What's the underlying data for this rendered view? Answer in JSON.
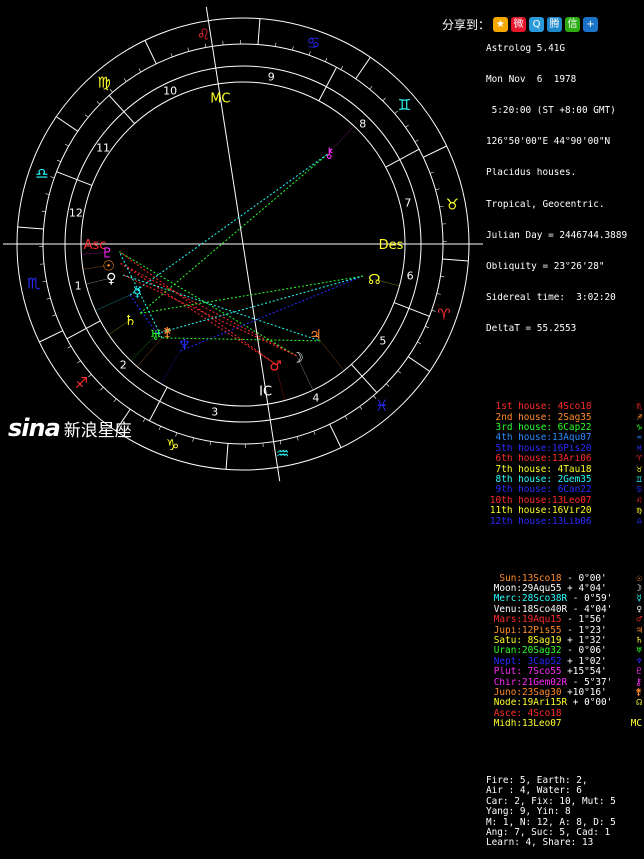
{
  "header": {
    "lines": [
      "Astrolog 5.41G",
      "Mon Nov  6  1978",
      " 5:20:00 (ST +8:00 GMT)",
      "126°50'00\"E 44°90'00\"N",
      "Placidus houses.",
      "Tropical, Geocentric.",
      "Julian Day = 2446744.3889",
      "Obliquity = 23°26'28\"",
      "Sidereal time:  3:02:20",
      "DeltaT = 55.2553"
    ]
  },
  "share": {
    "label": "分享到：",
    "icons": [
      {
        "name": "star-share-icon",
        "glyph": "★",
        "color": "#f7a800"
      },
      {
        "name": "weibo-share-icon",
        "glyph": "微",
        "color": "#e6162d"
      },
      {
        "name": "qzone-share-icon",
        "glyph": "Q",
        "color": "#2a9ad8"
      },
      {
        "name": "tencent-share-icon",
        "glyph": "腾",
        "color": "#1e88c8"
      },
      {
        "name": "wechat-share-icon",
        "glyph": "信",
        "color": "#2bad13"
      },
      {
        "name": "more-share-icon",
        "glyph": "+",
        "color": "#1a73c8"
      }
    ]
  },
  "houses": [
    {
      "label": "1st house:",
      "value": " 4Sco18",
      "color": "#ff2b2b",
      "sym": "♏"
    },
    {
      "label": "2nd house:",
      "value": " 2Sag35",
      "color": "#ff8c2b",
      "sym": "♐"
    },
    {
      "label": "3rd house:",
      "value": " 6Cap22",
      "color": "#2bff2b",
      "sym": "♑"
    },
    {
      "label": "4th house:",
      "value": "13Aqu07",
      "color": "#2b8cff",
      "sym": "♒"
    },
    {
      "label": "5th house:",
      "value": "16Pis20",
      "color": "#2b2bff",
      "sym": "♓"
    },
    {
      "label": "6th house:",
      "value": "13Ari06",
      "color": "#ff2b2b",
      "sym": "♈"
    },
    {
      "label": "7th house:",
      "value": " 4Tau18",
      "color": "#ffff2b",
      "sym": "♉"
    },
    {
      "label": "8th house:",
      "value": " 2Gem35",
      "color": "#2bffff",
      "sym": "♊"
    },
    {
      "label": "9th house:",
      "value": " 6Can22",
      "color": "#2b2bff",
      "sym": "♋"
    },
    {
      "label": "10th house:",
      "value": "13Leo07",
      "color": "#ff2b2b",
      "sym": "♌"
    },
    {
      "label": "11th house:",
      "value": "16Vir20",
      "color": "#ffff2b",
      "sym": "♍"
    },
    {
      "label": "12th house:",
      "value": "13Lib06",
      "color": "#2b2bff",
      "sym": "♎"
    }
  ],
  "planets": [
    {
      "label": "Sun:",
      "value": "13Sco18",
      "extra": " - 0°00'",
      "color": "#ff8c2b",
      "sym": "☉"
    },
    {
      "label": "Moon:",
      "value": "29Aqu55",
      "extra": " + 4°04'",
      "color": "#ffffff",
      "sym": "☽"
    },
    {
      "label": "Merc:",
      "value": "28Sco38R",
      "extra": " - 0°59'",
      "color": "#2bffff",
      "sym": "☿"
    },
    {
      "label": "Venu:",
      "value": "18Sco40R",
      "extra": " - 4°04'",
      "color": "#ffffff",
      "sym": "♀"
    },
    {
      "label": "Mars:",
      "value": "19Aqu15",
      "extra": " - 1°56'",
      "color": "#ff2b2b",
      "sym": "♂"
    },
    {
      "label": "Jupi:",
      "value": "12Pis55",
      "extra": " - 1°23'",
      "color": "#ff8c2b",
      "sym": "♃"
    },
    {
      "label": "Satu:",
      "value": " 8Sag19",
      "extra": " + 1°32'",
      "color": "#ffff2b",
      "sym": "♄"
    },
    {
      "label": "Uran:",
      "value": "20Sag32",
      "extra": " - 0°06'",
      "color": "#2bff2b",
      "sym": "♅"
    },
    {
      "label": "Nept:",
      "value": " 3Cap52",
      "extra": " + 1°02'",
      "color": "#2b2bff",
      "sym": "♆"
    },
    {
      "label": "Plut:",
      "value": " 7Sco55",
      "extra": " +15°54'",
      "color": "#ff2bff",
      "sym": "♇"
    },
    {
      "label": "Chir:",
      "value": "21Gem02R",
      "extra": " - 5°37'",
      "color": "#ff2bff",
      "sym": "⚷"
    },
    {
      "label": "Juno:",
      "value": "23Sag30",
      "extra": " +10°16'",
      "color": "#ff8c2b",
      "sym": "⚵"
    },
    {
      "label": "Node:",
      "value": "19Ari15R",
      "extra": " + 0°00'",
      "color": "#ffff2b",
      "sym": "☊"
    },
    {
      "label": "Asce:",
      "value": " 4Sco18",
      "extra": "",
      "color": "#ff2b2b",
      "sym": "Asc"
    },
    {
      "label": "Midh:",
      "value": "13Leo07",
      "extra": "",
      "color": "#ffff2b",
      "sym": "MC"
    }
  ],
  "stats": [
    "Fire: 5, Earth: 2,",
    "Air : 4, Water: 6",
    "Car: 2, Fix: 10, Mut: 5",
    "Yang: 9, Yin: 8",
    "M: 1, N: 12, A: 8, D: 5",
    "Ang: 7, Suc: 5, Cad: 1",
    "Learn: 4, Share: 13"
  ],
  "brand": {
    "logo": "sina",
    "name": "新浪星座",
    "logo_color": "#ffffff"
  },
  "chart_labels": {
    "asc": "Asc",
    "des": "Des",
    "mc": "MC",
    "ic": "IC",
    "house_numbers": [
      "1",
      "2",
      "3",
      "4",
      "5",
      "6",
      "7",
      "8",
      "9",
      "10",
      "11",
      "12"
    ],
    "signs": [
      "♈",
      "♉",
      "♊",
      "♋",
      "♌",
      "♍",
      "♎",
      "♏",
      "♐",
      "♑",
      "♒",
      "♓"
    ]
  }
}
